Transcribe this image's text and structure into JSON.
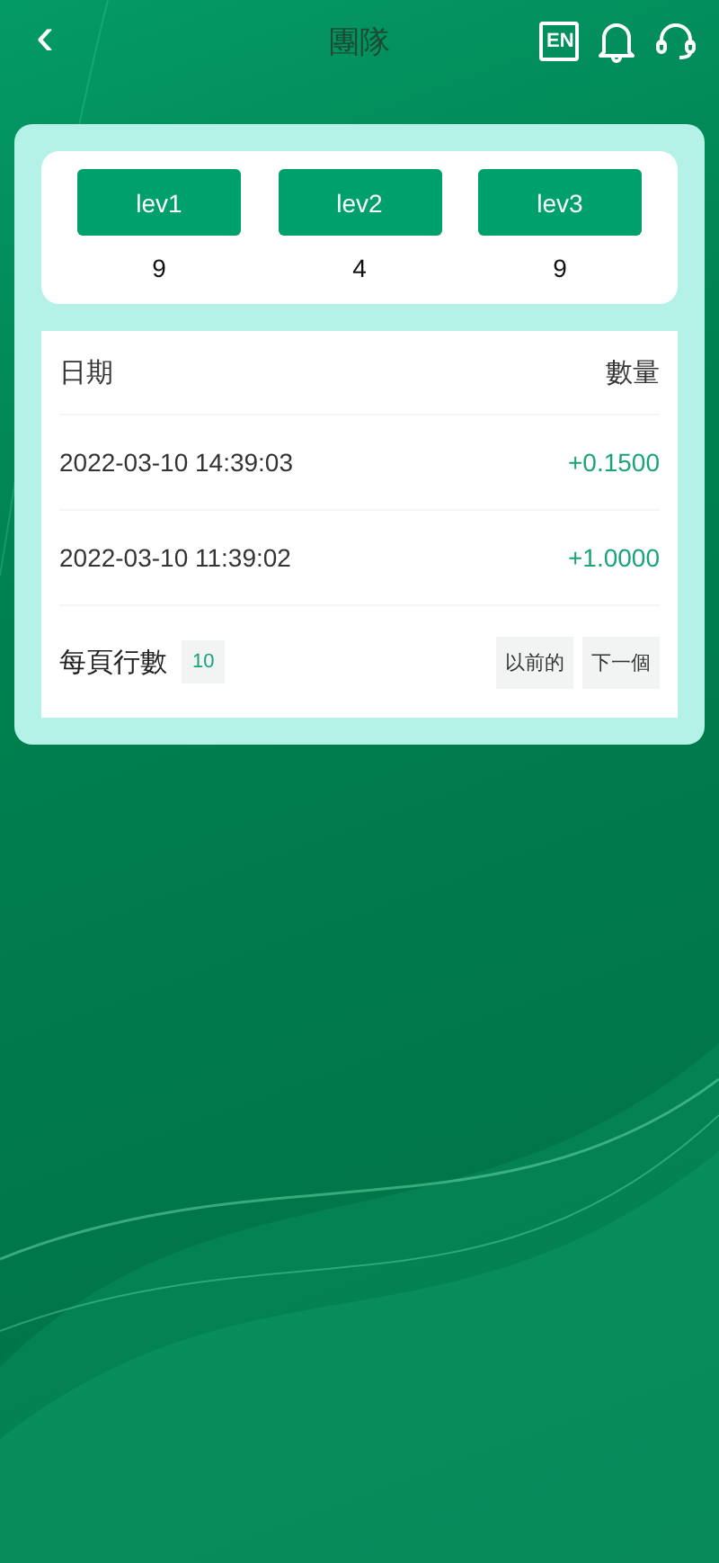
{
  "header": {
    "back": "‹",
    "title": "團隊",
    "lang": "EN"
  },
  "levels": [
    {
      "label": "lev1",
      "count": "9"
    },
    {
      "label": "lev2",
      "count": "4"
    },
    {
      "label": "lev3",
      "count": "9"
    }
  ],
  "table": {
    "columns": [
      "日期",
      "數量"
    ],
    "rows": [
      {
        "date": "2022-03-10 14:39:03",
        "amount": "+0.1500"
      },
      {
        "date": "2022-03-10 11:39:02",
        "amount": "+1.0000"
      }
    ]
  },
  "pager": {
    "label": "每頁行數",
    "page_size": "10",
    "prev": "以前的",
    "next": "下一個"
  }
}
